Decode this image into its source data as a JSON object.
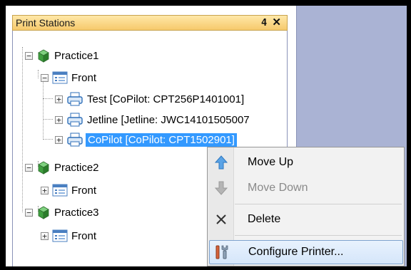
{
  "panel": {
    "title": "Print Stations",
    "pin_icon": "pin-icon",
    "close_icon": "close-icon"
  },
  "tree": {
    "practice1": {
      "label": "Practice1",
      "expander": "−",
      "front": {
        "label": "Front",
        "expander": "−",
        "printers": [
          {
            "label": "Test [CoPilot: CPT256P1401001]",
            "expander": "+"
          },
          {
            "label": "Jetline [Jetline: JWC14101505007",
            "expander": "+"
          },
          {
            "label": "CoPilot [CoPilot: CPT1502901]",
            "expander": "+",
            "selected": true
          }
        ]
      }
    },
    "practice2": {
      "label": "Practice2",
      "expander": "−",
      "front": {
        "label": "Front",
        "expander": "+"
      }
    },
    "practice3": {
      "label": "Practice3",
      "expander": "−",
      "front": {
        "label": "Front",
        "expander": "+"
      }
    }
  },
  "context_menu": {
    "items": [
      {
        "label": "Move Up",
        "icon": "arrow-up-icon",
        "enabled": true
      },
      {
        "label": "Move Down",
        "icon": "arrow-down-icon",
        "enabled": false
      },
      {
        "label": "Delete",
        "icon": "delete-x-icon",
        "enabled": true
      },
      {
        "label": "Configure Printer...",
        "icon": "tools-icon",
        "enabled": true,
        "hovered": true
      }
    ]
  },
  "colors": {
    "selection": "#3399ff",
    "title_bar": "#f6c96b",
    "workspace": "#aab3d4"
  }
}
